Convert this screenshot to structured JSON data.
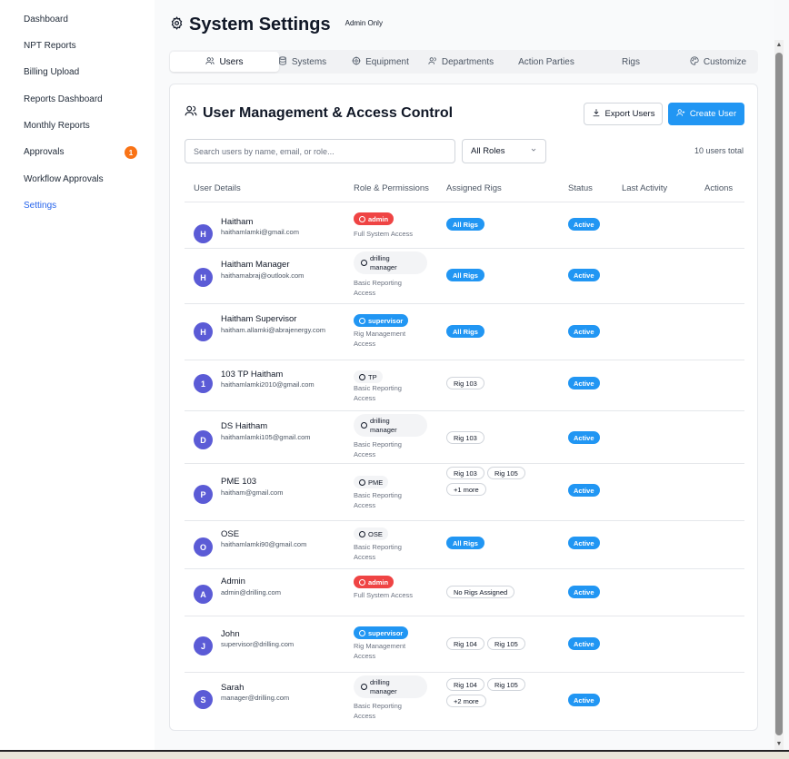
{
  "sidebar": {
    "items": [
      {
        "label": "Dashboard"
      },
      {
        "label": "NPT Reports"
      },
      {
        "label": "Billing Upload"
      },
      {
        "label": "Reports Dashboard"
      },
      {
        "label": "Monthly Reports"
      },
      {
        "label": "Approvals",
        "badge": "1"
      },
      {
        "label": "Workflow Approvals"
      },
      {
        "label": "Settings",
        "active": true
      }
    ]
  },
  "header": {
    "icon": "gear-icon",
    "title": "System Settings",
    "badge": "Admin Only"
  },
  "tabs": [
    {
      "label": "Users",
      "icon": "users-icon",
      "active": true
    },
    {
      "label": "Systems",
      "icon": "database-icon"
    },
    {
      "label": "Equipment",
      "icon": "crosshair-icon"
    },
    {
      "label": "Departments",
      "icon": "people-icon"
    },
    {
      "label": "Action Parties"
    },
    {
      "label": "Rigs"
    },
    {
      "label": "Customize",
      "icon": "palette-icon"
    }
  ],
  "panel": {
    "title": "User Management & Access Control",
    "export_label": "Export Users",
    "create_label": "Create User",
    "search_placeholder": "Search users by name, email, or role...",
    "role_filter": "All Roles",
    "total": "10 users total"
  },
  "columns": [
    "User Details",
    "Role & Permissions",
    "Assigned Rigs",
    "Status",
    "Last Activity",
    "Actions"
  ],
  "colors": {
    "accent": "#2196f3",
    "admin_role": "#ef4444",
    "notification": "#f97316"
  },
  "users": [
    {
      "initial": "H",
      "name": "Haitham",
      "email": "haithamlamki@gmail.com",
      "role": "admin",
      "role_style": "red",
      "access": "Full System Access",
      "rigs": [
        "All Rigs"
      ],
      "status": "Active"
    },
    {
      "initial": "H",
      "name": "Haitham Manager",
      "email": "haithamabraj@outlook.com",
      "role_lines": [
        "drilling",
        "manager"
      ],
      "role_style": "gray2",
      "access": "Basic Reporting Access",
      "rigs": [
        "All Rigs"
      ],
      "status": "Active"
    },
    {
      "initial": "H",
      "name": "Haitham Supervisor",
      "email": "haitham.allamki@abrajenergy.com",
      "role": "supervisor",
      "role_style": "blue",
      "access": "Rig Management Access",
      "rigs": [
        "All Rigs"
      ],
      "status": "Active"
    },
    {
      "initial": "1",
      "name": "103 TP Haitham",
      "email": "haithamlamki2010@gmail.com",
      "role": "TP",
      "role_style": "gray1",
      "access": "Basic Reporting Access",
      "rigs": [
        "Rig 103"
      ],
      "status": "Active"
    },
    {
      "initial": "D",
      "name": "DS Haitham",
      "email": "haithamlamki105@gmail.com",
      "role_lines": [
        "drilling",
        "manager"
      ],
      "role_style": "gray2",
      "access": "Basic Reporting Access",
      "rigs": [
        "Rig 103"
      ],
      "status": "Active"
    },
    {
      "initial": "P",
      "name": "PME 103",
      "email": "haitham@gmail.com",
      "role": "PME",
      "role_style": "gray1",
      "access": "Basic Reporting Access",
      "rigs": [
        "Rig 103",
        "Rig 105"
      ],
      "more": "+1 more",
      "status": "Active"
    },
    {
      "initial": "O",
      "name": "OSE",
      "email": "haithamlamki90@gmail.com",
      "role": "OSE",
      "role_style": "gray1",
      "access": "Basic Reporting Access",
      "rigs": [
        "All Rigs"
      ],
      "status": "Active"
    },
    {
      "initial": "A",
      "name": "Admin",
      "email": "admin@drilling.com",
      "role": "admin",
      "role_style": "red",
      "access": "Full System Access",
      "rigs": [
        "No Rigs Assigned"
      ],
      "status": "Active"
    },
    {
      "initial": "J",
      "name": "John",
      "email": "supervisor@drilling.com",
      "role": "supervisor",
      "role_style": "blue",
      "access": "Rig Management Access",
      "rigs": [
        "Rig 104",
        "Rig 105"
      ],
      "status": "Active"
    },
    {
      "initial": "S",
      "name": "Sarah",
      "email": "manager@drilling.com",
      "role_lines": [
        "drilling",
        "manager"
      ],
      "role_style": "gray2",
      "access": "Basic Reporting Access",
      "rigs": [
        "Rig 104",
        "Rig 105"
      ],
      "more": "+2 more",
      "status": "Active"
    }
  ]
}
